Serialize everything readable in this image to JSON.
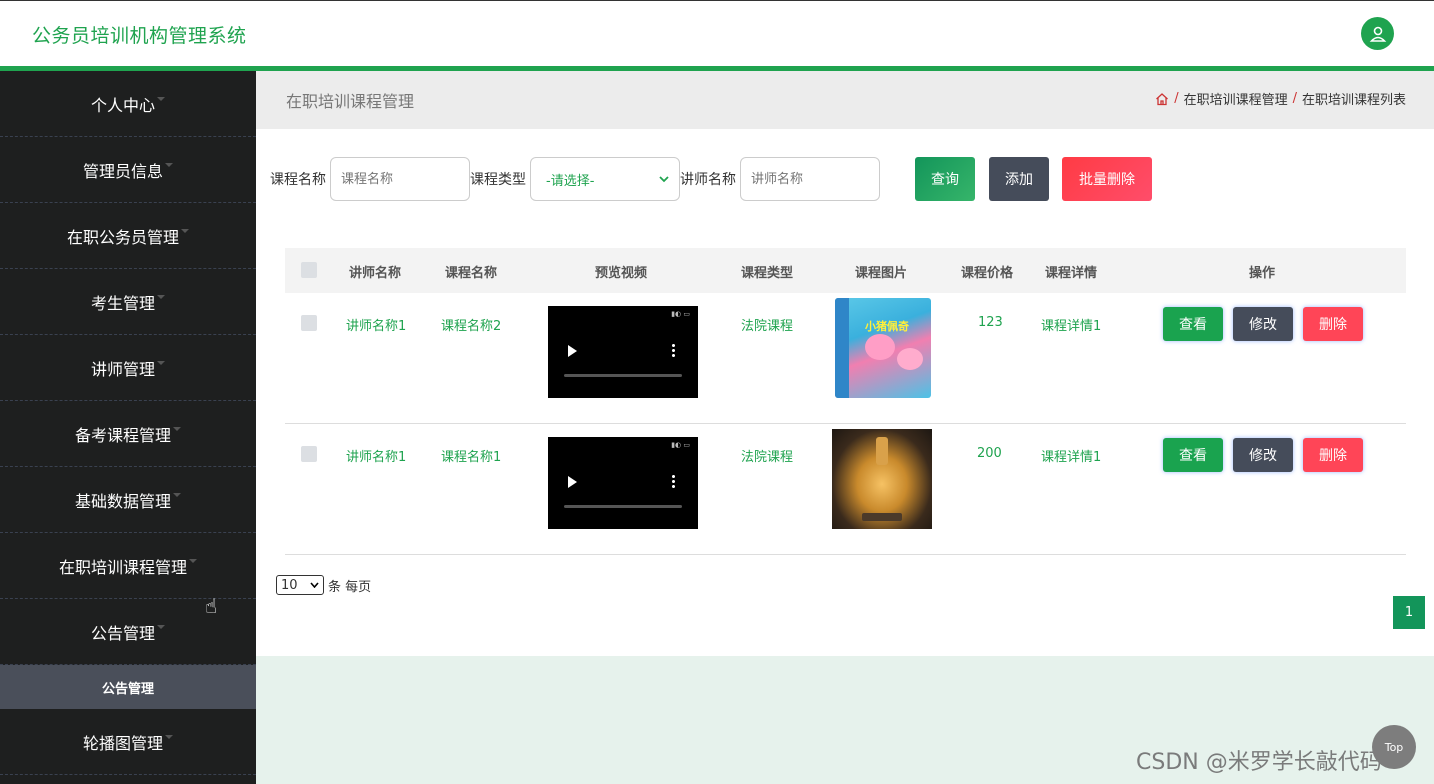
{
  "app": {
    "title": "公务员培训机构管理系统",
    "user_icon": "user-avatar-icon"
  },
  "sidebar": {
    "items": [
      {
        "label": "个人中心"
      },
      {
        "label": "管理员信息"
      },
      {
        "label": "在职公务员管理"
      },
      {
        "label": "考生管理"
      },
      {
        "label": "讲师管理"
      },
      {
        "label": "备考课程管理"
      },
      {
        "label": "基础数据管理"
      },
      {
        "label": "在职培训课程管理"
      },
      {
        "label": "公告管理"
      }
    ],
    "sub_item": "公告管理",
    "last_item": "轮播图管理"
  },
  "page": {
    "title": "在职培训课程管理",
    "breadcrumb": [
      "在职培训课程管理",
      "在职培训课程列表"
    ],
    "breadcrumb_sep": "/"
  },
  "search": {
    "course_name_label": "课程名称",
    "course_name_placeholder": "课程名称",
    "course_type_label": "课程类型",
    "course_type_value": "-请选择-",
    "teacher_label": "讲师名称",
    "teacher_placeholder": "讲师名称",
    "query_btn": "查询",
    "add_btn": "添加",
    "batch_delete_btn": "批量删除"
  },
  "table": {
    "headers": [
      "讲师名称",
      "课程名称",
      "预览视频",
      "课程类型",
      "课程图片",
      "课程价格",
      "课程详情",
      "操作"
    ],
    "rows": [
      {
        "teacher": "讲师名称1",
        "course": "课程名称2",
        "type": "法院课程",
        "price": "123",
        "detail": "课程详情1"
      },
      {
        "teacher": "讲师名称1",
        "course": "课程名称1",
        "type": "法院课程",
        "price": "200",
        "detail": "课程详情1"
      }
    ],
    "view_btn": "查看",
    "edit_btn": "修改",
    "delete_btn": "删除"
  },
  "book_cover_text": "小猪佩奇",
  "pager": {
    "page_size": "10",
    "per_page_text": "条 每页",
    "current_page": "1"
  },
  "top_button": "Top",
  "watermark": "CSDN @米罗学长敲代码",
  "colors": {
    "primary": "#1fa34f",
    "sidebar": "#1e1f1f",
    "danger": "#ff4557",
    "dark": "#454c5a"
  }
}
